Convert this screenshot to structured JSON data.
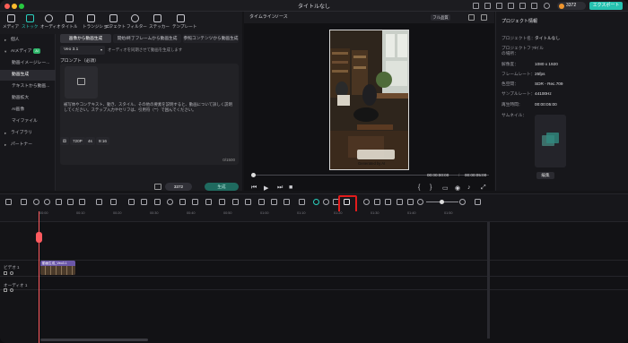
{
  "window": {
    "title": "タイトルなし",
    "credits": "3372",
    "export_label": "エクスポート"
  },
  "toolbar": [
    {
      "label": "メディア"
    },
    {
      "label": "ストック"
    },
    {
      "label": "オーディオ"
    },
    {
      "label": "タイトル"
    },
    {
      "label": "トランジション"
    },
    {
      "label": "エフェクト"
    },
    {
      "label": "フィルター"
    },
    {
      "label": "ステッカー"
    },
    {
      "label": "テンプレート"
    }
  ],
  "sidebar": [
    {
      "label": "個人",
      "kind": "cat"
    },
    {
      "label": "AIメディア",
      "kind": "cat",
      "badge": "AI"
    },
    {
      "label": "動画イメージレー...",
      "kind": "item"
    },
    {
      "label": "動画生成",
      "kind": "item",
      "selected": true
    },
    {
      "label": "テキストから動画...",
      "kind": "item"
    },
    {
      "label": "動画拡大",
      "kind": "item"
    },
    {
      "label": "AI画像",
      "kind": "item"
    },
    {
      "label": "マイファイル",
      "kind": "item"
    },
    {
      "label": "ライブラリ",
      "kind": "cat"
    },
    {
      "label": "パートナー",
      "kind": "cat"
    }
  ],
  "generator": {
    "tabs": [
      "画像から動画生成",
      "開始/終了フレームから動画生成",
      "参照コンテンツから動画生成"
    ],
    "model": "Veo 3.1",
    "model_note": "オーディオを同期させて動画を生成します",
    "prompt_label": "プロンプト（必須）",
    "hint": "被写体やコンテキスト、動き、スタイル、その他の要素を説明すると、動画について詳しく説明してください。ステップ入力やセリフは、引用符（\"\"）で囲んでください。",
    "counter": "0/1500",
    "resolution": "720P",
    "duration": "4s",
    "ratio": "9:16",
    "credit_cost": "3372",
    "generate_label": "生成"
  },
  "player": {
    "tabs": [
      "タイムライン",
      "ソース"
    ],
    "quality": "フル品質",
    "watermark": "Generated by AI",
    "time_current": "00:00:00:00",
    "time_total": "00:00:05:00"
  },
  "project": {
    "header": "プロジェクト情報",
    "rows": [
      {
        "label": "プロジェクト名：",
        "value": "タイトルなし"
      },
      {
        "label": "プロジェクトファイルの場所：",
        "value": "/"
      },
      {
        "label": "解像度：",
        "value": "1080 x 1920"
      },
      {
        "label": "フレームレート：",
        "value": "25fps"
      },
      {
        "label": "色空間：",
        "value": "SDR - Rec.709"
      },
      {
        "label": "サンプルレート：",
        "value": "44100Hz"
      },
      {
        "label": "再生時間：",
        "value": "00:00:05:00"
      },
      {
        "label": "サムネイル：",
        "value": ""
      }
    ],
    "edit_label": "編集"
  },
  "timeline": {
    "ruler": [
      "00:00",
      "00:10",
      "00:20",
      "00:30",
      "00:40",
      "00:50",
      "01:00",
      "01:10",
      "01:20",
      "01:30",
      "01:40",
      "01:50"
    ],
    "video_track": "ビデオ 1",
    "audio_track": "オーディオ 1",
    "clip_label": "動画生成_Veo3.1"
  }
}
